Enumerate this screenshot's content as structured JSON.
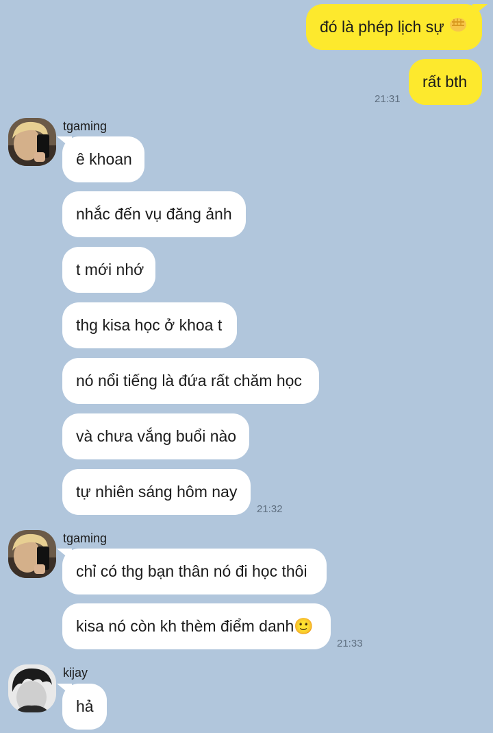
{
  "messages": {
    "outgoing": [
      {
        "text": "đó là phép lịch sự",
        "emoji": "fist-bump-emoji"
      },
      {
        "text": "rất bth",
        "time": "21:31"
      }
    ],
    "group1": {
      "sender": "tgaming",
      "avatar": "blonde-selfie-avatar",
      "lines": [
        "ê khoan",
        "nhắc đến vụ đăng ảnh",
        "t mới nhớ",
        "thg kisa học ở khoa t",
        "nó nổi tiếng là đứa rất chăm học",
        "và chưa vắng buổi nào",
        "tự nhiên sáng hôm nay"
      ],
      "time": "21:32"
    },
    "group2": {
      "sender": "tgaming",
      "avatar": "blonde-selfie-avatar",
      "lines": [
        "chỉ có thg bạn thân nó đi học thôi",
        "kisa nó còn kh thèm điểm danh"
      ],
      "emoji": "🙂",
      "time": "21:33"
    },
    "group3": {
      "sender": "kijay",
      "avatar": "dark-hair-avatar",
      "lines": [
        "hả"
      ]
    }
  },
  "colors": {
    "background": "#b1c6dc",
    "outgoing_bubble": "#fde92d",
    "incoming_bubble": "#ffffff",
    "timestamp": "#5f6f80"
  }
}
